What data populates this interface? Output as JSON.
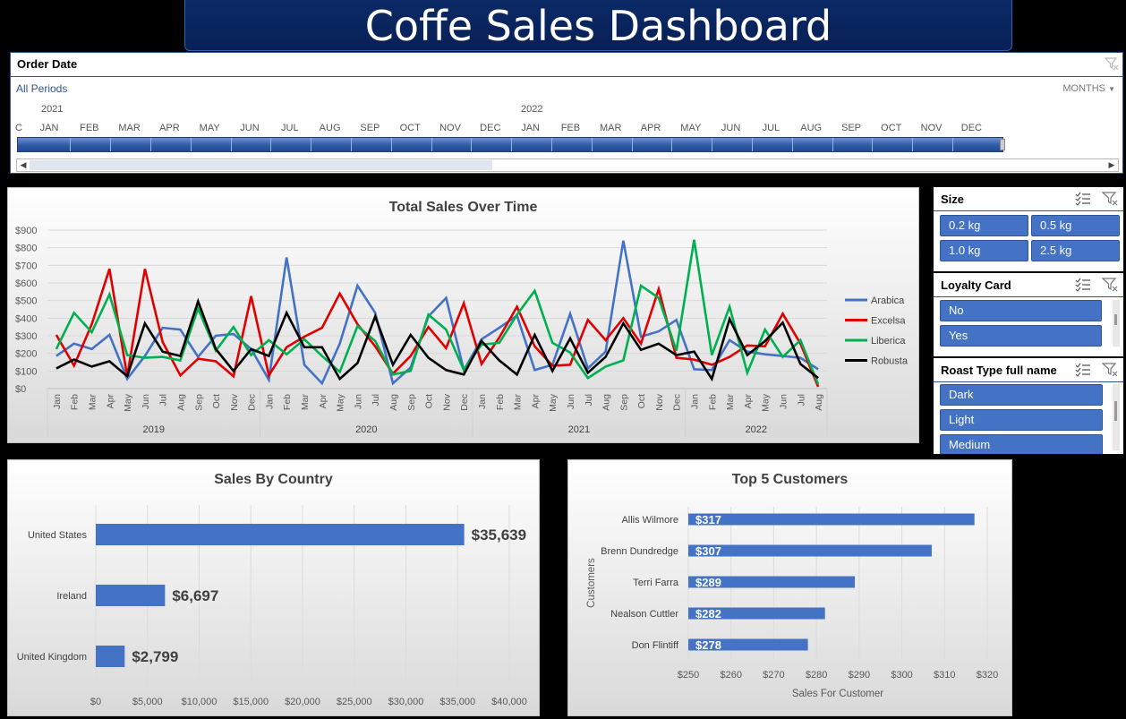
{
  "title": "Coffe Sales Dashboard",
  "timeline": {
    "title": "Order Date",
    "period": "All Periods",
    "level": "MONTHS",
    "level_icon": "dropdown-caret-icon",
    "years": [
      "2021",
      "2022"
    ],
    "lead_month": "C",
    "months": [
      "JAN",
      "FEB",
      "MAR",
      "APR",
      "MAY",
      "JUN",
      "JUL",
      "AUG",
      "SEP",
      "OCT",
      "NOV",
      "DEC",
      "JAN",
      "FEB",
      "MAR",
      "APR",
      "MAY",
      "JUN",
      "JUL",
      "AUG",
      "SEP",
      "OCT",
      "NOV",
      "DEC"
    ],
    "selected_fraction": 1.0
  },
  "slicers": {
    "size": {
      "title": "Size",
      "options": [
        "0.2 kg",
        "0.5 kg",
        "1.0 kg",
        "2.5 kg"
      ]
    },
    "loyalty": {
      "title": "Loyalty Card",
      "options": [
        "No",
        "Yes"
      ]
    },
    "roast": {
      "title": "Roast Type full name",
      "options": [
        "Dark",
        "Light",
        "Medium"
      ]
    }
  },
  "colors": {
    "Arabica": "#4472c4",
    "Excelsa": "#e00000",
    "Liberica": "#00b050",
    "Robusta": "#000000",
    "bar": "#4472c4",
    "banner": "#0b2a66"
  },
  "chart_data": [
    {
      "type": "line",
      "title": "Total Sales Over Time",
      "months": [
        "Jan",
        "Feb",
        "Mar",
        "Apr",
        "May",
        "Jun",
        "Jul",
        "Aug",
        "Sep",
        "Oct",
        "Nov",
        "Dec",
        "Jan",
        "Feb",
        "Mar",
        "Apr",
        "May",
        "Jun",
        "Jul",
        "Aug",
        "Sep",
        "Oct",
        "Nov",
        "Dec",
        "Jan",
        "Feb",
        "Mar",
        "Apr",
        "May",
        "Jun",
        "Jul",
        "Aug",
        "Sep",
        "Oct",
        "Nov",
        "Dec",
        "Jan",
        "Feb",
        "Mar",
        "Apr",
        "May",
        "Jun",
        "Jul",
        "Aug"
      ],
      "years": [
        "2019",
        "2020",
        "2021",
        "2022"
      ],
      "yticks": [
        "$900",
        "$800",
        "$700",
        "$600",
        "$500",
        "$400",
        "$300",
        "$200",
        "$100",
        "$0"
      ],
      "ylim": [
        0,
        900
      ],
      "legend_position": "right",
      "series": [
        {
          "name": "Arabica",
          "values": [
            185,
            255,
            225,
            305,
            55,
            185,
            345,
            335,
            180,
            300,
            310,
            225,
            50,
            745,
            135,
            30,
            255,
            585,
            430,
            30,
            120,
            410,
            515,
            105,
            280,
            345,
            415,
            105,
            135,
            425,
            115,
            210,
            840,
            295,
            325,
            390,
            110,
            105,
            275,
            210,
            195,
            185,
            175,
            110
          ]
        },
        {
          "name": "Excelsa",
          "values": [
            305,
            130,
            365,
            680,
            70,
            680,
            265,
            75,
            170,
            155,
            70,
            525,
            75,
            235,
            295,
            345,
            540,
            365,
            240,
            85,
            185,
            350,
            230,
            485,
            140,
            290,
            465,
            240,
            130,
            135,
            390,
            275,
            400,
            255,
            565,
            175,
            165,
            135,
            180,
            245,
            240,
            425,
            255,
            10
          ]
        },
        {
          "name": "Liberica",
          "values": [
            225,
            430,
            320,
            535,
            190,
            175,
            180,
            160,
            455,
            215,
            350,
            190,
            275,
            195,
            280,
            185,
            95,
            355,
            270,
            80,
            100,
            420,
            335,
            105,
            250,
            260,
            420,
            555,
            260,
            205,
            60,
            125,
            160,
            585,
            515,
            215,
            845,
            190,
            465,
            90,
            335,
            180,
            275,
            25
          ]
        },
        {
          "name": "Robusta",
          "values": [
            115,
            165,
            125,
            155,
            70,
            370,
            210,
            185,
            495,
            225,
            100,
            225,
            185,
            430,
            235,
            235,
            55,
            145,
            410,
            135,
            305,
            175,
            105,
            80,
            270,
            160,
            80,
            305,
            100,
            285,
            90,
            180,
            370,
            220,
            255,
            190,
            210,
            55,
            395,
            190,
            270,
            375,
            140,
            60
          ]
        }
      ]
    },
    {
      "type": "bar",
      "title": "Sales By Country",
      "categories": [
        "United States",
        "Ireland",
        "United Kingdom"
      ],
      "values": [
        35639,
        6697,
        2799
      ],
      "labels": [
        "$35,639",
        "$6,697",
        "$2,799"
      ],
      "xticks": [
        "$0",
        "$5,000",
        "$10,000",
        "$15,000",
        "$20,000",
        "$25,000",
        "$30,000",
        "$35,000",
        "$40,000"
      ],
      "xlim": [
        0,
        40000
      ]
    },
    {
      "type": "bar",
      "title": "Top 5 Customers",
      "xlabel": "Sales For Customer",
      "ylabel": "Customers",
      "categories": [
        "Allis Wilmore",
        "Brenn Dundredge",
        "Terri Farra",
        "Nealson Cuttler",
        "Don Flintiff"
      ],
      "values": [
        317,
        307,
        289,
        282,
        278
      ],
      "labels": [
        "$317",
        "$307",
        "$289",
        "$282",
        "$278"
      ],
      "xticks": [
        "$250",
        "$260",
        "$270",
        "$280",
        "$290",
        "$300",
        "$310",
        "$320"
      ],
      "xlim": [
        250,
        320
      ]
    }
  ]
}
